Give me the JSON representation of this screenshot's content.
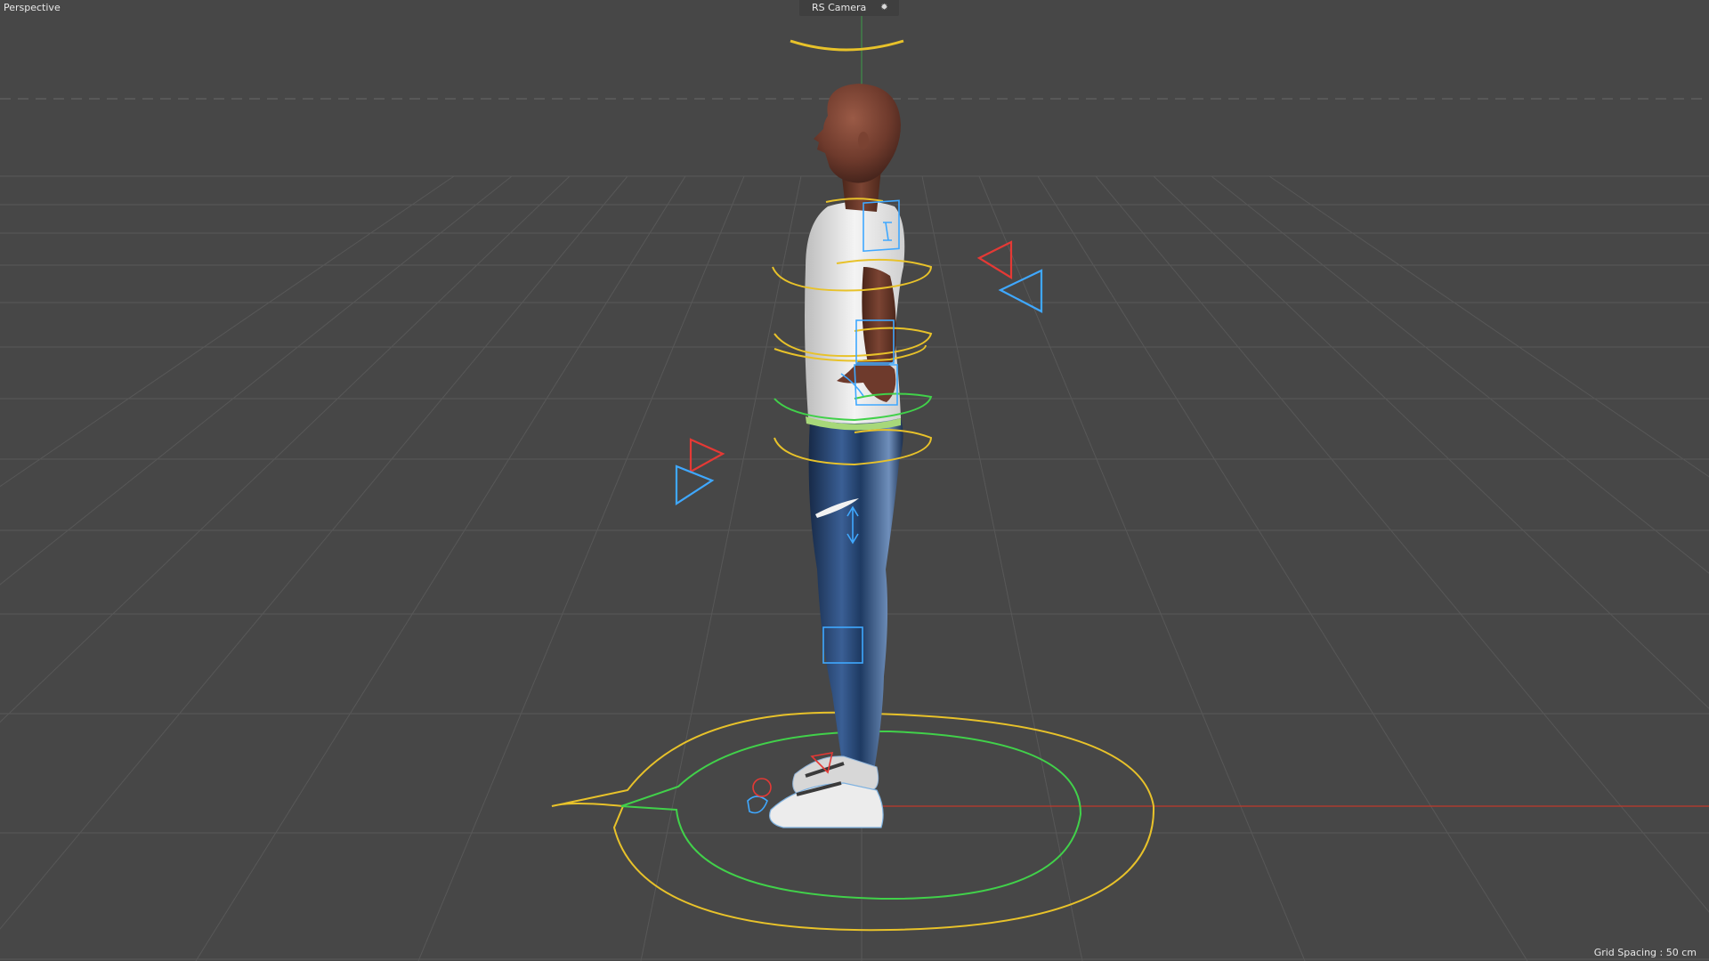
{
  "viewport": {
    "view_name": "Perspective",
    "camera_name": "RS Camera",
    "camera_options_icon": "camera-settings-icon",
    "grid_spacing": "Grid Spacing : 50 cm"
  },
  "scene": {
    "object": "rigged human character, side view, white t-shirt, navy leggings, white sneakers",
    "colors": {
      "background": "#474747",
      "grid": "#5a5a5a",
      "x_axis": "#c0392b",
      "y_axis": "#4caf50",
      "controller_yellow": "#f1c40f",
      "controller_green": "#3ddc3d",
      "controller_blue": "#3fa8ff",
      "controller_red": "#e53935",
      "skin": "#6b3a2a",
      "shirt": "#e9e9e9",
      "pants": "#1f3a60",
      "shoes": "#e6e6e6"
    }
  }
}
